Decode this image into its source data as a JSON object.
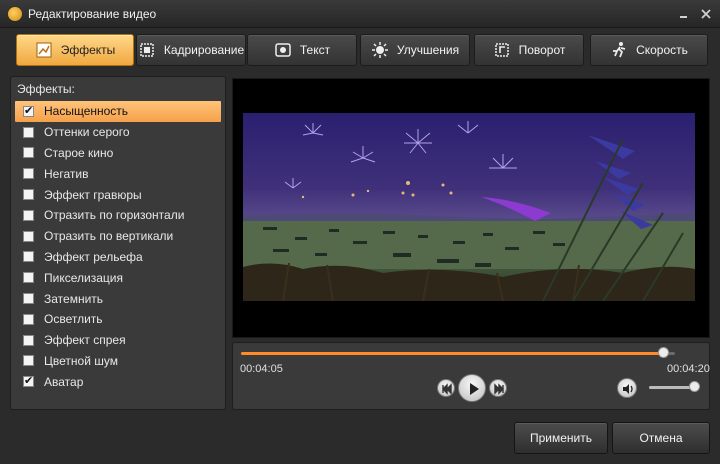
{
  "window": {
    "title": "Редактирование видео",
    "minimize_icon": "minimize-icon",
    "close_icon": "close-icon"
  },
  "tabs": [
    {
      "label": "Эффекты",
      "icon": "effects-icon",
      "active": true
    },
    {
      "label": "Кадрирование",
      "icon": "crop-icon",
      "active": false
    },
    {
      "label": "Текст",
      "icon": "text-icon",
      "active": false
    },
    {
      "label": "Улучшения",
      "icon": "brightness-icon",
      "active": false
    },
    {
      "label": "Поворот",
      "icon": "rotate-icon",
      "active": false
    },
    {
      "label": "Скорость",
      "icon": "speed-runner-icon",
      "active": false
    }
  ],
  "effects": {
    "heading": "Эффекты:",
    "items": [
      {
        "label": "Насыщенность",
        "checked": true,
        "selected": true
      },
      {
        "label": "Оттенки серого",
        "checked": false,
        "selected": false
      },
      {
        "label": "Старое кино",
        "checked": false,
        "selected": false
      },
      {
        "label": "Негатив",
        "checked": false,
        "selected": false
      },
      {
        "label": "Эффект гравюры",
        "checked": false,
        "selected": false
      },
      {
        "label": "Отразить по горизонтали",
        "checked": false,
        "selected": false
      },
      {
        "label": "Отразить по вертикали",
        "checked": false,
        "selected": false
      },
      {
        "label": "Эффект рельефа",
        "checked": false,
        "selected": false
      },
      {
        "label": "Пикселизация",
        "checked": false,
        "selected": false
      },
      {
        "label": "Затемнить",
        "checked": false,
        "selected": false
      },
      {
        "label": "Осветлить",
        "checked": false,
        "selected": false
      },
      {
        "label": "Эффект спрея",
        "checked": false,
        "selected": false
      },
      {
        "label": "Цветной шум",
        "checked": false,
        "selected": false
      },
      {
        "label": "Аватар",
        "checked": true,
        "selected": false
      }
    ]
  },
  "player": {
    "current_time": "00:04:05",
    "end_time": "00:04:20",
    "progress": 0.975,
    "volume": 0.95
  },
  "buttons": {
    "apply": "Применить",
    "cancel": "Отмена"
  },
  "colors": {
    "accent": "#f5a04a",
    "progress": "#ff8a2a"
  }
}
